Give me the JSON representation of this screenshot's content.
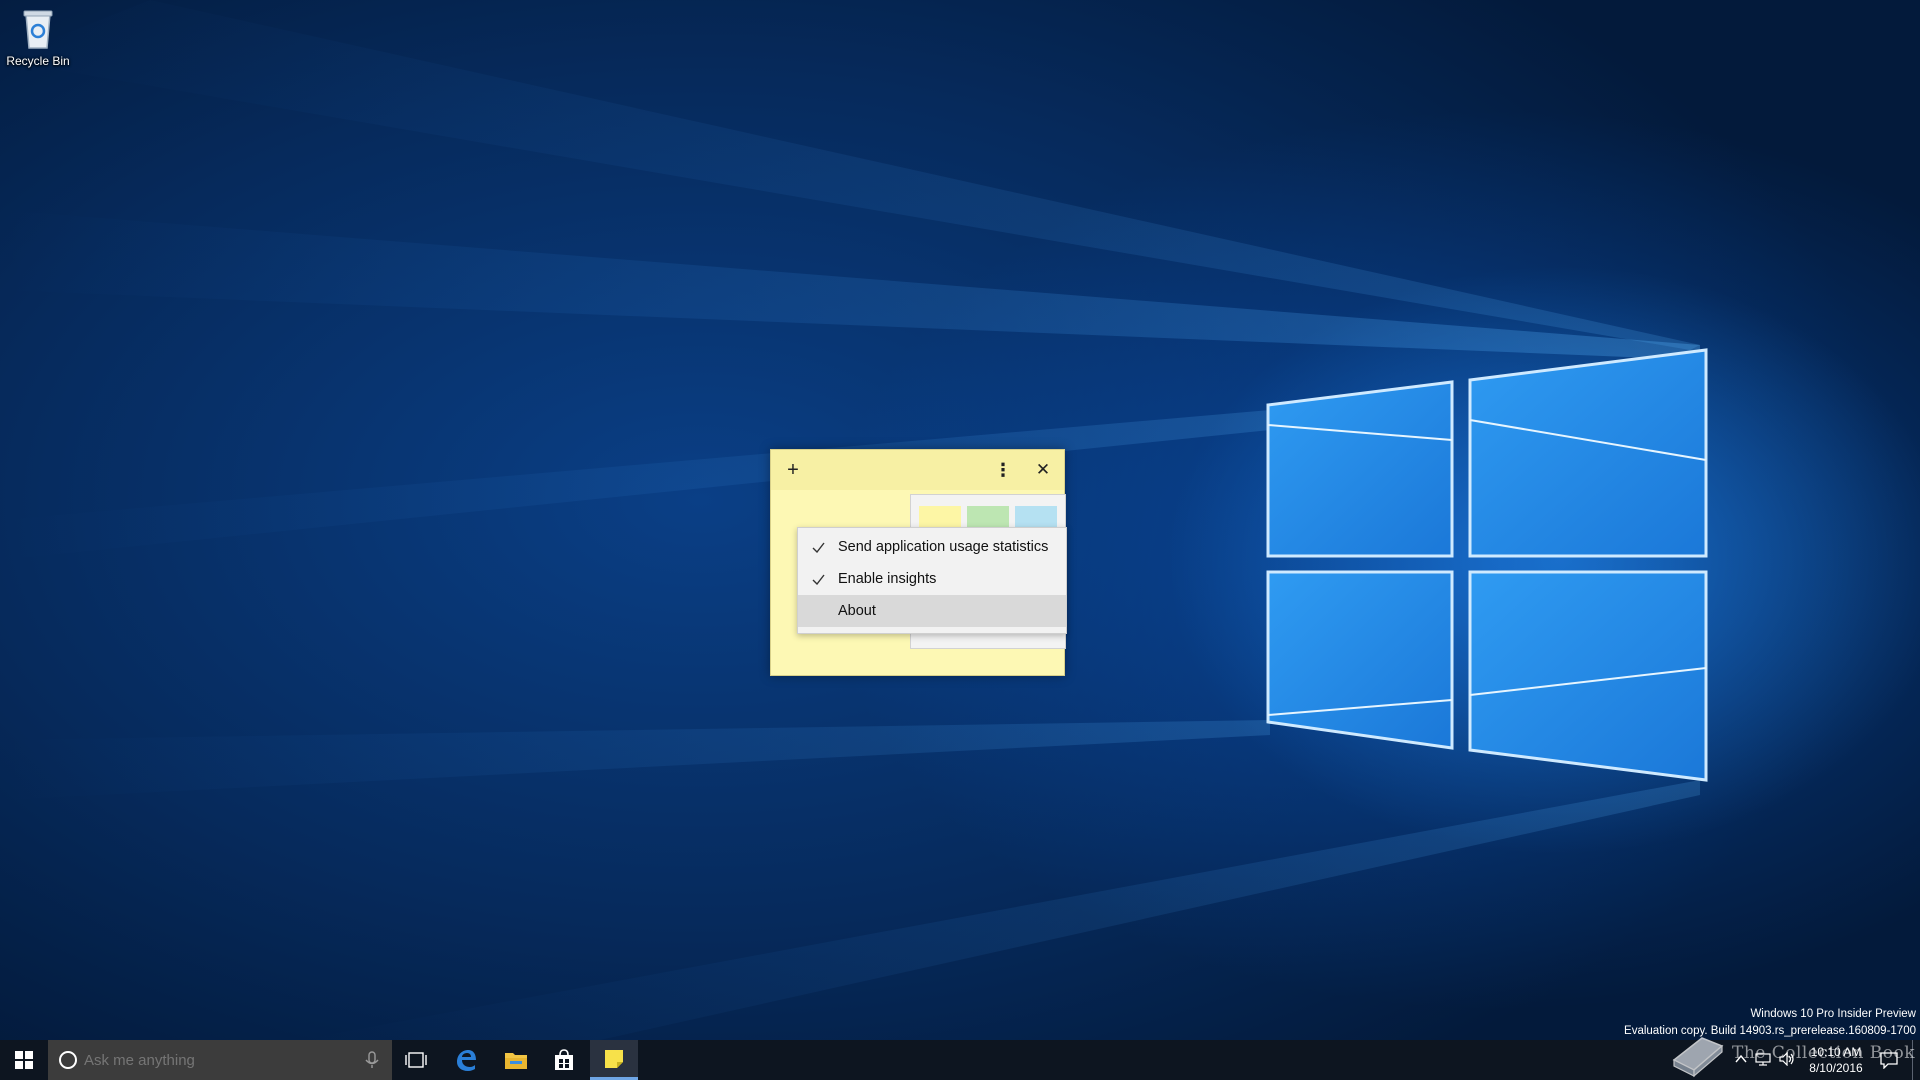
{
  "desktop": {
    "icons": [
      {
        "label": "Recycle Bin",
        "icon": "recycle-bin-icon"
      }
    ]
  },
  "sticky_note": {
    "title_buttons": {
      "add": "+",
      "more": "⋮",
      "close": "✕"
    },
    "swatch_colors": [
      "#fdf6a5",
      "#bde6b2",
      "#b5e1f2"
    ],
    "context_menu": [
      {
        "label": "Send application usage statistics",
        "checked": true
      },
      {
        "label": "Enable insights",
        "checked": true
      },
      {
        "label": "About",
        "checked": false,
        "highlighted": true
      }
    ]
  },
  "watermark": {
    "line1": "Windows 10 Pro Insider Preview",
    "line2": "Evaluation copy. Build 14903.rs_prerelease.160809-1700"
  },
  "taskbar": {
    "search_placeholder": "Ask me anything",
    "pinned": [
      "task-view-icon",
      "edge-icon",
      "file-explorer-icon",
      "store-icon",
      "sticky-notes-icon"
    ],
    "active_app": "sticky-notes-icon",
    "clock": {
      "time": "10:10 AM",
      "date": "8/10/2016"
    }
  },
  "overlay_brand": {
    "text": "The Collection Book"
  },
  "colors": {
    "wallpaper": "#0a3f86",
    "taskbar": "#0d1520",
    "sticky_yellow": "#fdf8b4",
    "menu_hover": "#d9d9d9"
  }
}
